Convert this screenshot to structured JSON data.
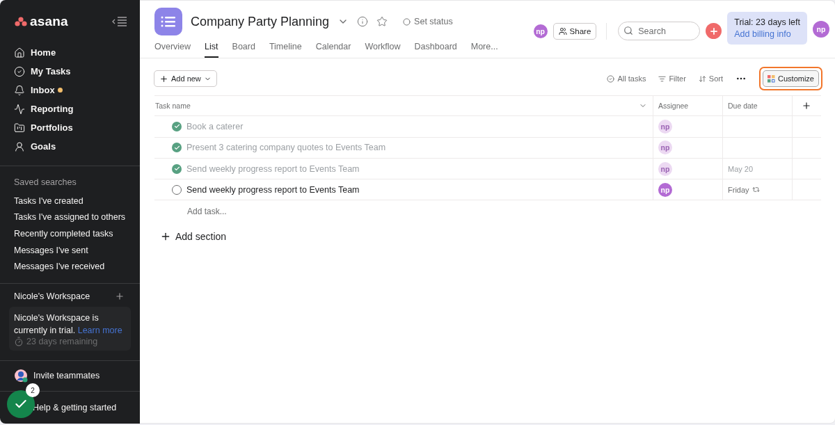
{
  "sidebar": {
    "logo": "asana",
    "nav": [
      {
        "label": "Home",
        "unread": false
      },
      {
        "label": "My Tasks",
        "unread": false
      },
      {
        "label": "Inbox",
        "unread": true
      },
      {
        "label": "Reporting",
        "unread": false
      },
      {
        "label": "Portfolios",
        "unread": false
      },
      {
        "label": "Goals",
        "unread": false
      }
    ],
    "saved_searches": {
      "title": "Saved searches",
      "items": [
        "Tasks I've created",
        "Tasks I've assigned to others",
        "Recently completed tasks",
        "Messages I've sent",
        "Messages I've received"
      ]
    },
    "workspace": {
      "name": "Nicole's Workspace",
      "trial_text": "Nicole's Workspace is currently in trial.",
      "link": "Learn more",
      "remaining": "23 days remaining"
    },
    "invite": "Invite teammates",
    "help": {
      "label": "Help & getting started",
      "badge": "2"
    }
  },
  "header": {
    "title": "Company Party Planning",
    "set_status": "Set status",
    "tabs": [
      {
        "label": "Overview",
        "selected": false
      },
      {
        "label": "List",
        "selected": true
      },
      {
        "label": "Board",
        "selected": false
      },
      {
        "label": "Timeline",
        "selected": false
      },
      {
        "label": "Calendar",
        "selected": false
      },
      {
        "label": "Workflow",
        "selected": false
      },
      {
        "label": "Dashboard",
        "selected": false
      },
      {
        "label": "More...",
        "selected": false
      }
    ],
    "member_avatar": "np",
    "share": "Share",
    "search": {
      "placeholder": "Search"
    },
    "trial": {
      "title": "Trial: 23 days left",
      "link": "Add billing info"
    },
    "user_avatar": "np"
  },
  "toolbar": {
    "add_new": "Add new",
    "all_tasks": "All tasks",
    "filter": "Filter",
    "sort": "Sort",
    "customize": {
      "label": "Customize",
      "highlighted": true
    }
  },
  "table": {
    "columns": [
      "Task name",
      "Assignee",
      "Due date"
    ],
    "rows": [
      {
        "name": "Book a caterer",
        "completed": true,
        "assignee": "np",
        "due": "",
        "recurring": false
      },
      {
        "name": "Present 3 catering company quotes to Events Team",
        "completed": true,
        "assignee": "np",
        "due": "",
        "recurring": false
      },
      {
        "name": "Send weekly progress report to Events Team",
        "completed": true,
        "assignee": "np",
        "due": "May 20",
        "recurring": false
      },
      {
        "name": "Send weekly progress report to Events Team",
        "completed": false,
        "assignee": "np",
        "due": "Friday",
        "recurring": true
      }
    ],
    "add_task": "Add task...",
    "add_section": "Add section"
  }
}
